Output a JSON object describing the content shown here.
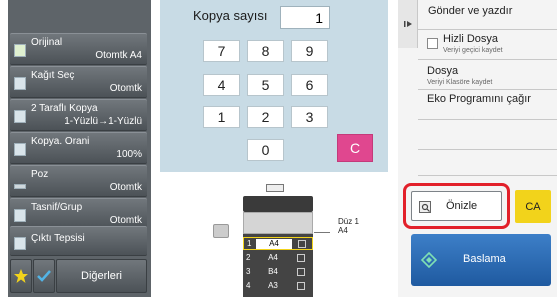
{
  "sidebar": {
    "items": [
      {
        "label": "Orijinal",
        "value": "Otomtk A4",
        "icon": "original-doc-icon"
      },
      {
        "label": "Kağıt Seç",
        "value": "Otomtk",
        "icon": "paper-select-icon"
      },
      {
        "label": "2 Taraflı Kopya",
        "value": "1-Yüzlü→1-Yüzlü",
        "icon": "duplex-copy-icon"
      },
      {
        "label": "Kopya. Orani",
        "value": "100%",
        "icon": "copy-ratio-icon"
      },
      {
        "label": "Poz",
        "value": "Otomtk",
        "icon": "exposure-icon"
      },
      {
        "label": "Tasnif/Grup",
        "value": "Otomtk",
        "icon": "sort-group-icon"
      },
      {
        "label": "Çıktı Tepsisi",
        "value": "",
        "icon": "output-tray-icon"
      }
    ],
    "bottom": {
      "star_icon": "star-icon",
      "check_icon": "check-icon",
      "more_label": "Diğerleri"
    }
  },
  "keypad": {
    "title": "Kopya sayısı",
    "count": "1",
    "keys": [
      "7",
      "8",
      "9",
      "4",
      "5",
      "6",
      "1",
      "2",
      "3",
      "0"
    ],
    "clear_label": "C"
  },
  "preview_machine": {
    "output_label_line1": "Düz 1",
    "output_label_line2": "A4",
    "trays": [
      {
        "number": "1",
        "size": "A4"
      },
      {
        "number": "2",
        "size": "A4"
      },
      {
        "number": "3",
        "size": "B4"
      },
      {
        "number": "4",
        "size": "A3"
      }
    ]
  },
  "right_panel": {
    "collapse_icon": "panel-collapse-icon",
    "send_and_print": "Gönder ve yazdır",
    "quick_file": {
      "label": "Hizli Dosya",
      "sub": "Veriyi geçici kaydet"
    },
    "file": {
      "label": "Dosya",
      "sub": "Veriyi Klasöre kaydet"
    },
    "eco_program": "Eko Programını çağır",
    "preview_label": "Önizle",
    "ca_label": "CA",
    "start_label": "Baslama"
  },
  "colors": {
    "accent_yellow": "#f2d31b",
    "start_blue": "#2e6fb7",
    "preview_highlight": "#e2202a",
    "clear_button": "#e0478f"
  }
}
